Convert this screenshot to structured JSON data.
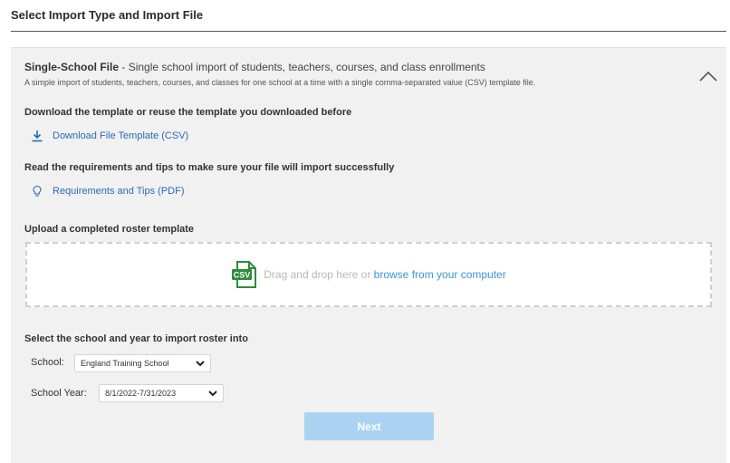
{
  "page": {
    "title": "Select Import Type and Import File"
  },
  "import_type": {
    "name": "Single-School File",
    "separator": " - ",
    "summary": "Single school import of students, teachers, courses, and class enrollments",
    "description": "A simple import of students, teachers, courses, and classes for one school at a time with a single comma-separated value (CSV) template file.",
    "expanded_icon": "chevron-up-icon"
  },
  "template_section": {
    "heading": "Download the template or reuse the template you downloaded before",
    "link_label": "Download File Template (CSV)",
    "icon": "download-icon"
  },
  "requirements_section": {
    "heading": "Read the requirements and tips to make sure your file will import successfully",
    "link_label": "Requirements and Tips (PDF)",
    "icon": "lightbulb-icon"
  },
  "upload_section": {
    "heading": "Upload a completed roster template",
    "drop_text": "Drag and drop here or",
    "browse_label": "browse from your computer",
    "icon": "csv-file-icon",
    "icon_text": "CSV"
  },
  "school_year_section": {
    "heading": "Select the school and year to import roster into",
    "school_label": "School:",
    "school_value": "England Training School",
    "year_label": "School Year:",
    "year_value": "8/1/2022-7/31/2023"
  },
  "next_button": {
    "label": "Next",
    "state": "disabled"
  },
  "colors": {
    "link": "#2a6ab7",
    "browse": "#3b94d9",
    "next_disabled": "#a9d3f1",
    "csv_icon": "#2e8b3a",
    "panel_bg": "#f1f1f1"
  }
}
